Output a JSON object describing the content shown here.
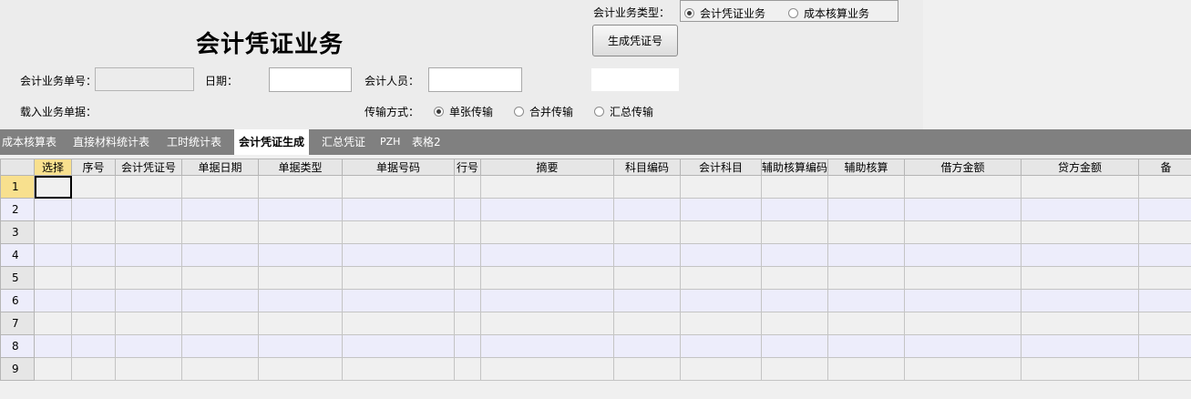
{
  "title": "会计凭证业务",
  "form": {
    "doc_no_label": "会计业务单号：",
    "doc_no_value": "",
    "date_label": "日期：",
    "date_value": "",
    "staff_label": "会计人员：",
    "staff_value": "",
    "load_label": "载入业务单据：",
    "transfer_label": "传输方式：",
    "transfer_options": [
      "单张传输",
      "合并传输",
      "汇总传输"
    ],
    "transfer_selected": "单张传输",
    "type_label": "会计业务类型：",
    "type_options": [
      "会计凭证业务",
      "成本核算业务"
    ],
    "type_selected": "会计凭证业务",
    "generate_button": "生成凭证号",
    "voucher_no_value": ""
  },
  "tabs": [
    "成本核算表",
    "直接材料统计表",
    "工时统计表",
    "会计凭证生成",
    "汇总凭证",
    "PZH",
    "表格2"
  ],
  "active_tab": "会计凭证生成",
  "grid": {
    "columns": [
      "选择",
      "序号",
      "会计凭证号",
      "单据日期",
      "单据类型",
      "单据号码",
      "行号",
      "摘要",
      "科目编码",
      "会计科目",
      "辅助核算编码",
      "辅助核算",
      "借方金额",
      "贷方金额",
      "备"
    ],
    "row_numbers": [
      "1",
      "2",
      "3",
      "4",
      "5",
      "6",
      "7",
      "8",
      "9"
    ],
    "active_row": "1",
    "active_column": "选择"
  },
  "colors": {
    "tab_bar": "#808080",
    "header_selected": "#f8e08e",
    "alt_row": "#ededfb"
  }
}
